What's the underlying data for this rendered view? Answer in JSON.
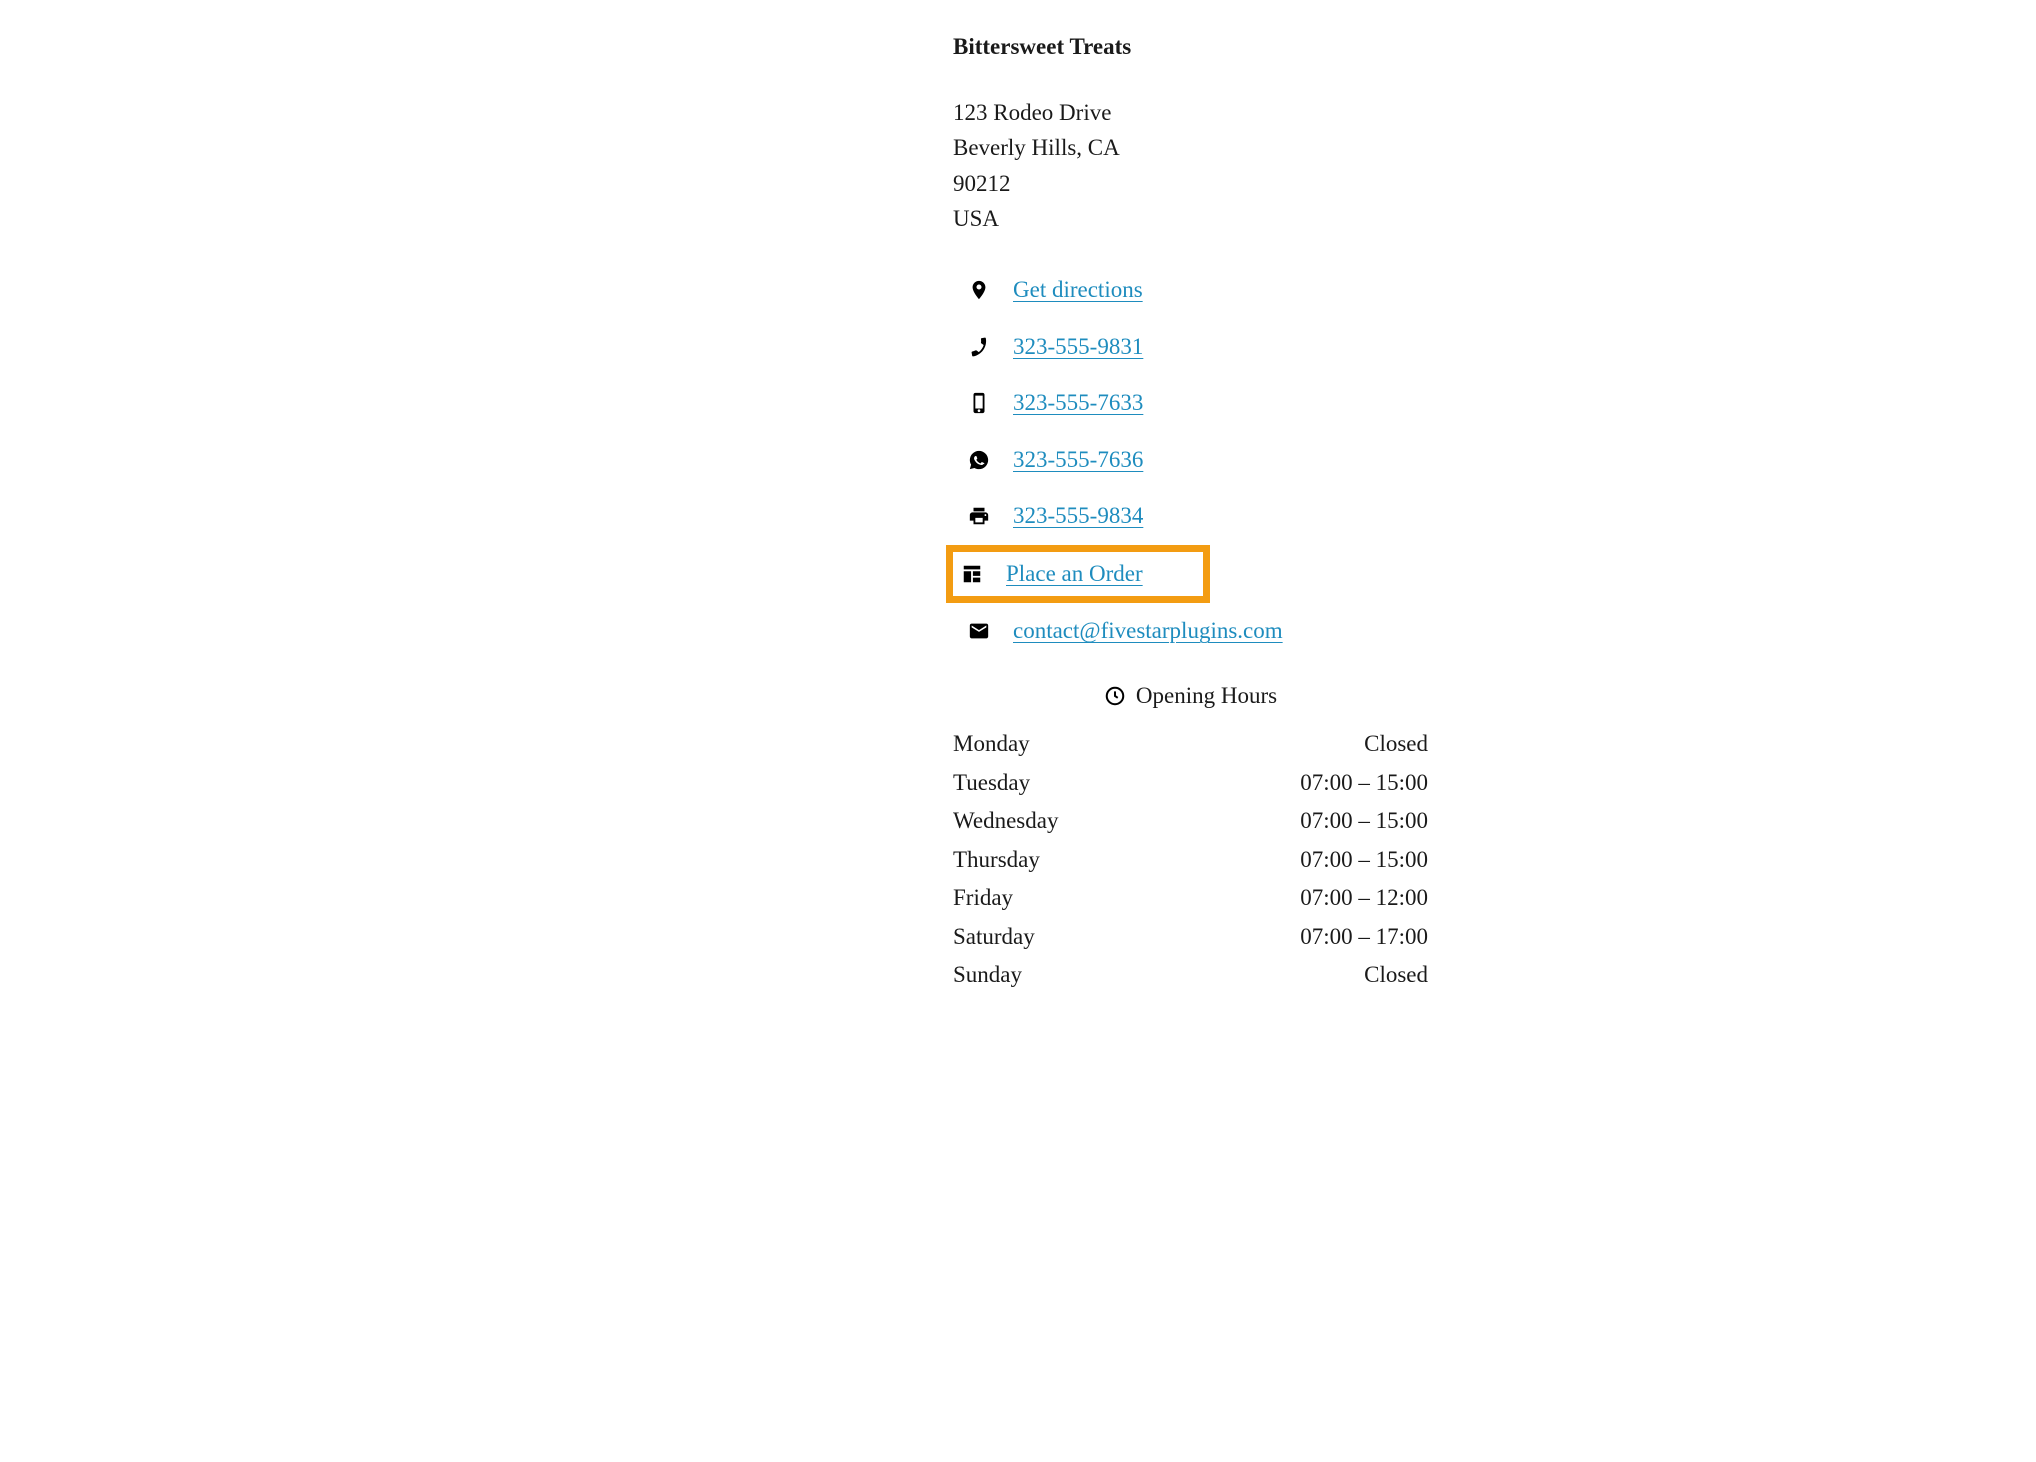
{
  "business": {
    "name": "Bittersweet Treats",
    "address": {
      "line1": "123 Rodeo Drive",
      "line2": "Beverly Hills, CA",
      "postal": "90212",
      "country": "USA"
    }
  },
  "contacts": {
    "directions": "Get directions",
    "phone": "323-555-9831",
    "mobile": "323-555-7633",
    "whatsapp": "323-555-7636",
    "fax": "323-555-9834",
    "order": "Place an Order",
    "email": "contact@fivestarplugins.com"
  },
  "hours": {
    "heading": "Opening Hours",
    "rows": [
      {
        "day": "Monday",
        "time": "Closed"
      },
      {
        "day": "Tuesday",
        "time": "07:00 – 15:00"
      },
      {
        "day": "Wednesday",
        "time": "07:00 – 15:00"
      },
      {
        "day": "Thursday",
        "time": "07:00 – 15:00"
      },
      {
        "day": "Friday",
        "time": "07:00 – 12:00"
      },
      {
        "day": "Saturday",
        "time": "07:00 – 17:00"
      },
      {
        "day": "Sunday",
        "time": "Closed"
      }
    ]
  }
}
